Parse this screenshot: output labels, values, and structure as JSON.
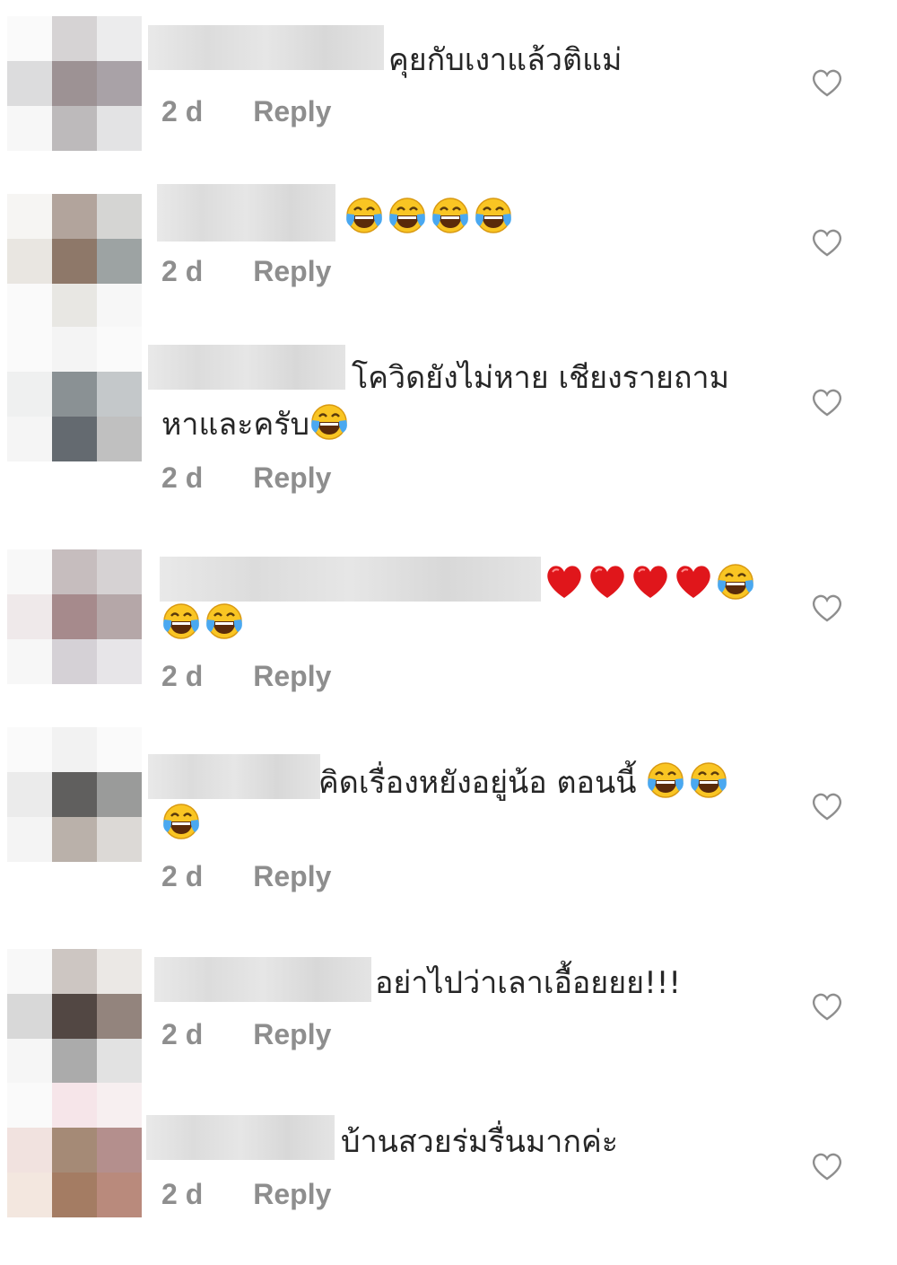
{
  "comments": [
    {
      "text": "คุยกับเงาแล้วติแม่",
      "time": "2 d",
      "reply": "Reply"
    },
    {
      "text": "",
      "time": "2 d",
      "reply": "Reply"
    },
    {
      "text": "โควิดยังไม่หาย เชียงรายถาม",
      "text2": "หาและครับ",
      "time": "2 d",
      "reply": "Reply"
    },
    {
      "text": "",
      "time": "2 d",
      "reply": "Reply"
    },
    {
      "text": "คิดเรื่องหยังอยู่น้อ ตอนนี้ ",
      "time": "2 d",
      "reply": "Reply"
    },
    {
      "text": "อย่าไปว่าเลาเอื้อยยย!!!",
      "time": "2 d",
      "reply": "Reply"
    },
    {
      "text": "บ้านสวยร่มรื่นมากค่ะ",
      "time": "2 d",
      "reply": "Reply"
    }
  ],
  "icons": {
    "like": "heart-outline-icon",
    "emoji_laugh": "face-with-tears-of-joy-icon",
    "emoji_heart": "red-heart-icon"
  },
  "colors": {
    "text": "#262626",
    "meta": "#8e8e8e",
    "heart": "#e0161b",
    "emoji": "#f9c523"
  }
}
